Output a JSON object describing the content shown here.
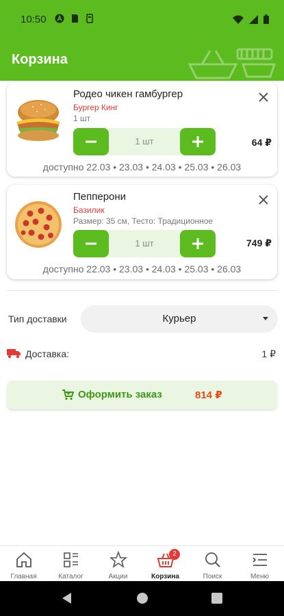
{
  "status_bar": {
    "time": "10:50",
    "icons": [
      "a-icon",
      "sd-card-icon",
      "usb-icon"
    ],
    "right_icons": [
      "wifi-icon",
      "signal-icon",
      "battery-icon"
    ]
  },
  "app_bar": {
    "title": "Корзина"
  },
  "cart_items": [
    {
      "name": "Родео чикен гамбургер",
      "store": "Бургер Кинг",
      "detail": "1 шт",
      "quantity": "1 шт",
      "price": "64 ₽",
      "availability": "доступно 22.03 • 23.03 • 24.03 • 25.03 • 26.03"
    },
    {
      "name": "Пепперони",
      "store": "Базилик",
      "detail": "Размер: 35 см, Тесто: Традиционное",
      "quantity": "1 шт",
      "price": "749 ₽",
      "availability": "доступно 22.03 • 23.03 • 24.03 • 25.03 • 26.03"
    }
  ],
  "delivery": {
    "type_label": "Тип доставки",
    "selected_type": "Курьер",
    "cost_label": "Доставка:",
    "cost_value": "1 ₽"
  },
  "checkout": {
    "label": "Оформить заказ",
    "total": "814 ₽"
  },
  "bottom_nav": {
    "items": [
      {
        "label": "Главная",
        "icon": "home-icon"
      },
      {
        "label": "Каталог",
        "icon": "catalog-icon"
      },
      {
        "label": "Акции",
        "icon": "star-icon"
      },
      {
        "label": "Корзина",
        "icon": "basket-icon",
        "badge": "2",
        "active": true
      },
      {
        "label": "Поиск",
        "icon": "search-icon"
      },
      {
        "label": "Меню",
        "icon": "menu-icon"
      }
    ]
  },
  "colors": {
    "brand_green": "#5cbb1e",
    "light_green": "#eaf6e2",
    "accent_red": "#e53935",
    "total_orange": "#e64a19"
  }
}
